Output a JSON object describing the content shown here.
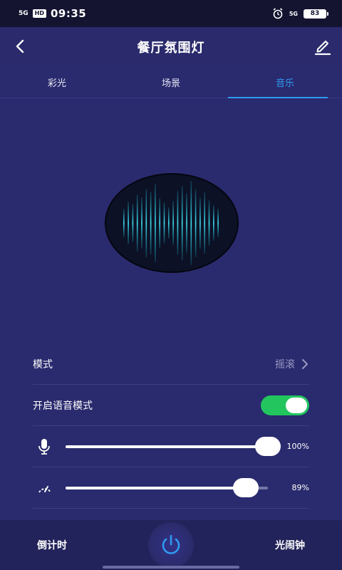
{
  "status": {
    "signal": "5G",
    "hd": "HD",
    "time": "09:35",
    "network": "5G",
    "battery": "83"
  },
  "header": {
    "title": "餐厅氛围灯"
  },
  "tabs": [
    {
      "label": "彩光",
      "active": false
    },
    {
      "label": "场景",
      "active": false
    },
    {
      "label": "音乐",
      "active": true
    }
  ],
  "settings": {
    "mode_label": "模式",
    "mode_value": "摇滚",
    "voice_label": "开启语音模式",
    "voice_on": true,
    "mic_value": "100%",
    "mic_level": 1.0,
    "speed_value": "89%",
    "speed_level": 0.89
  },
  "bottom": {
    "left_label": "倒计时",
    "right_label": "光闹钟"
  },
  "colors": {
    "accent": "#2f9bf0",
    "toggle_on": "#22c55e",
    "background": "#2a2a6e"
  }
}
